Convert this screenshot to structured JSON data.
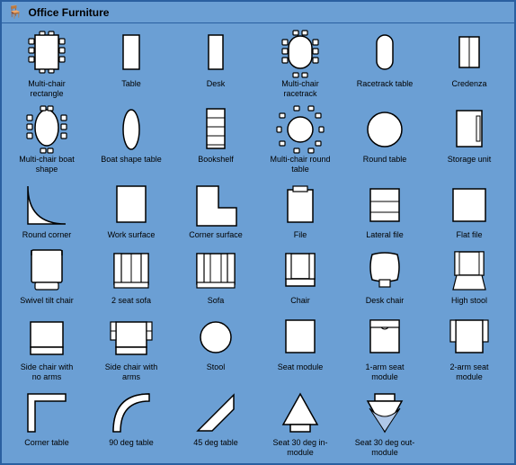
{
  "window": {
    "title": "Office Furniture"
  },
  "items": [
    {
      "id": "multi-chair-rectangle",
      "label": "Multi-chair rectangle"
    },
    {
      "id": "table",
      "label": "Table"
    },
    {
      "id": "desk",
      "label": "Desk"
    },
    {
      "id": "multi-chair-racetrack",
      "label": "Multi-chair racetrack"
    },
    {
      "id": "racetrack-table",
      "label": "Racetrack table"
    },
    {
      "id": "credenza",
      "label": "Credenza"
    },
    {
      "id": "multi-chair-boat-shape",
      "label": "Multi-chair boat shape"
    },
    {
      "id": "boat-shape-table",
      "label": "Boat shape table"
    },
    {
      "id": "bookshelf",
      "label": "Bookshelf"
    },
    {
      "id": "multi-chair-round-table",
      "label": "Multi-chair round table"
    },
    {
      "id": "round-table",
      "label": "Round table"
    },
    {
      "id": "storage-unit",
      "label": "Storage unit"
    },
    {
      "id": "round-corner",
      "label": "Round corner"
    },
    {
      "id": "work-surface",
      "label": "Work surface"
    },
    {
      "id": "corner-surface",
      "label": "Corner surface"
    },
    {
      "id": "file",
      "label": "File"
    },
    {
      "id": "lateral-file",
      "label": "Lateral file"
    },
    {
      "id": "flat-file",
      "label": "Flat file"
    },
    {
      "id": "swivel-tilt-chair",
      "label": "Swivel tilt chair"
    },
    {
      "id": "2-seat-sofa",
      "label": "2 seat sofa"
    },
    {
      "id": "sofa",
      "label": "Sofa"
    },
    {
      "id": "chair",
      "label": "Chair"
    },
    {
      "id": "desk-chair",
      "label": "Desk chair"
    },
    {
      "id": "high-stool",
      "label": "High stool"
    },
    {
      "id": "side-chair-no-arms",
      "label": "Side chair with no arms"
    },
    {
      "id": "side-chair-arms",
      "label": "Side chair with arms"
    },
    {
      "id": "stool",
      "label": "Stool"
    },
    {
      "id": "seat-module",
      "label": "Seat module"
    },
    {
      "id": "1-arm-seat-module",
      "label": "1-arm seat module"
    },
    {
      "id": "2-arm-seat-module",
      "label": "2-arm seat module"
    },
    {
      "id": "corner-table",
      "label": "Corner table"
    },
    {
      "id": "90-deg-table",
      "label": "90 deg table"
    },
    {
      "id": "45-deg-table",
      "label": "45 deg table"
    },
    {
      "id": "seat-30-deg-in",
      "label": "Seat 30 deg in-module"
    },
    {
      "id": "seat-30-deg-out",
      "label": "Seat 30 deg out-module"
    }
  ]
}
